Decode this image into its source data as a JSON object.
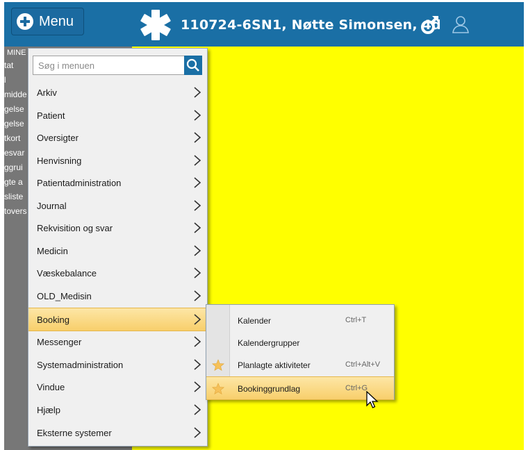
{
  "header": {
    "menu_label": "Menu",
    "patient_title": "110724-6SN1, Nøtte Simonsen, 4d",
    "brand_color": "#1a6fa5"
  },
  "left_panel": {
    "heading": "MINE",
    "items": [
      "tat",
      "l",
      "midde",
      "gelse",
      "gelse",
      "tkort",
      "esvar",
      "ggrui",
      "gte a",
      "sliste",
      "tovers"
    ]
  },
  "search": {
    "placeholder": "Søg i menuen"
  },
  "menu_items": [
    {
      "label": "Arkiv"
    },
    {
      "label": "Patient"
    },
    {
      "label": "Oversigter"
    },
    {
      "label": "Henvisning"
    },
    {
      "label": "Patientadministration"
    },
    {
      "label": "Journal"
    },
    {
      "label": "Rekvisition og svar"
    },
    {
      "label": "Medicin"
    },
    {
      "label": "Væskebalance"
    },
    {
      "label": "OLD_Medisin"
    },
    {
      "label": "Booking",
      "active": true
    },
    {
      "label": "Messenger"
    },
    {
      "label": "Systemadministration"
    },
    {
      "label": "Vindue"
    },
    {
      "label": "Hjælp"
    },
    {
      "label": "Eksterne systemer"
    }
  ],
  "submenu": [
    {
      "label": "Kalender",
      "shortcut": "Ctrl+T",
      "favorite": false
    },
    {
      "label": "Kalendergrupper",
      "shortcut": "",
      "favorite": false
    },
    {
      "label": "Planlagte aktiviteter",
      "shortcut": "Ctrl+Alt+V",
      "favorite": true
    },
    {
      "label": "Bookinggrundlag",
      "shortcut": "Ctrl+G",
      "favorite": true,
      "active": true
    }
  ],
  "icons": {
    "menu_button": "plus-circle-icon",
    "logo": "star-of-life-icon",
    "gender": "male-icon",
    "user": "user-icon",
    "search": "search-icon",
    "submenu_arrow": "chevron-right-icon",
    "favorite": "star-icon"
  }
}
